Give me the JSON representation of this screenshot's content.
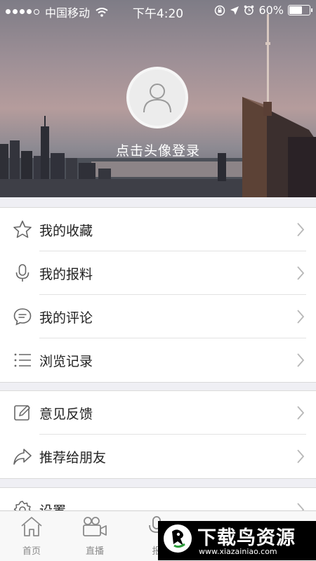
{
  "status_bar": {
    "carrier": "中国移动",
    "time": "下午4:20",
    "battery": "60%",
    "battery_level": 0.6
  },
  "header": {
    "login_prompt": "点击头像登录"
  },
  "menu_group_1": [
    {
      "label": "我的收藏",
      "icon": "star-icon"
    },
    {
      "label": "我的报料",
      "icon": "microphone-icon"
    },
    {
      "label": "我的评论",
      "icon": "comment-bubble-icon"
    },
    {
      "label": "浏览记录",
      "icon": "list-icon"
    }
  ],
  "menu_group_2": [
    {
      "label": "意见反馈",
      "icon": "edit-icon"
    },
    {
      "label": "推荐给朋友",
      "icon": "share-arrow-icon"
    }
  ],
  "menu_group_3": [
    {
      "label": "设置",
      "icon": "gear-icon"
    }
  ],
  "tab_bar": {
    "tabs": [
      {
        "label": "首页",
        "icon": "home-icon"
      },
      {
        "label": "直播",
        "icon": "video-camera-icon"
      },
      {
        "label": "报",
        "icon": "microphone-icon"
      }
    ]
  },
  "watermark": {
    "title": "下载鸟资源",
    "url": "www.xiazainiao.com"
  }
}
